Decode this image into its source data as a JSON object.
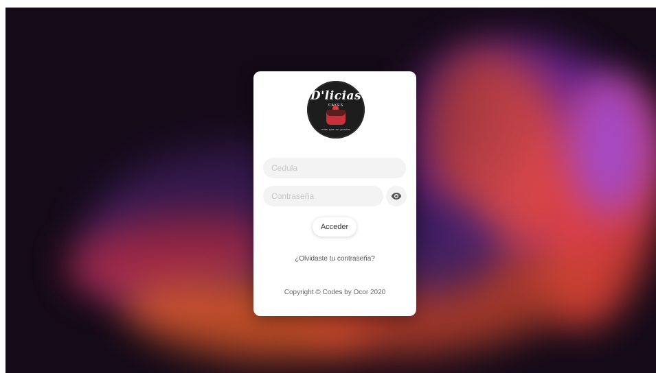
{
  "logo": {
    "brand": "D'licias",
    "sub": "CAKES",
    "ribbon": "más que un postre",
    "icon": "cake-logo"
  },
  "form": {
    "cedula_placeholder": "Cedula",
    "password_placeholder": "Contraseña",
    "toggle_icon": "eye-icon",
    "submit_label": "Acceder",
    "forgot_label": "¿Olvidaste tu contraseña?"
  },
  "footer": {
    "copyright": "Copyright © Codes by Ocor 2020"
  },
  "colors": {
    "card": "#ffffff",
    "input_bg": "#f3f3f3",
    "backdrop": "#140a18"
  }
}
